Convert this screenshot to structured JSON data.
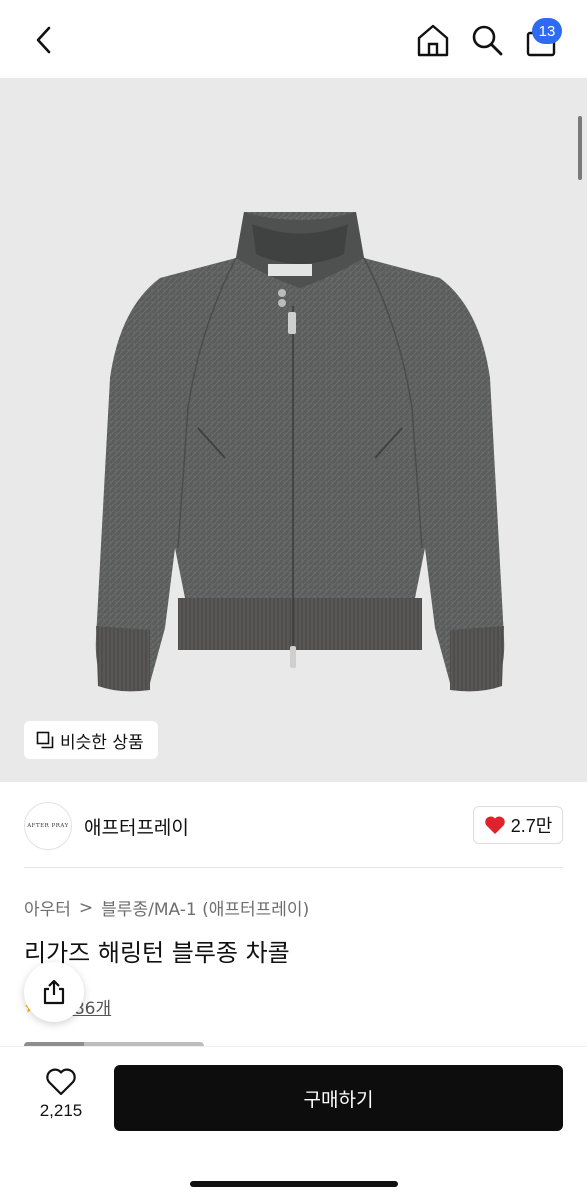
{
  "header": {
    "back_icon": "chevron-left-icon",
    "home_icon": "home-icon",
    "search_icon": "search-icon",
    "cart_icon": "shopping-bag-icon",
    "cart_count": "13",
    "badge_color": "#2f6bf0"
  },
  "hero": {
    "image": "jacket-image",
    "jacket_label": "AFTER PRAY",
    "similar_button_label": "비슷한 상품",
    "similar_icon": "copy-icon"
  },
  "brand": {
    "logo_text": "AFTER PRAY",
    "name": "애프터프레이",
    "likes": "2.7만",
    "heart_color": "#e0222a"
  },
  "product": {
    "category_main": "아우터",
    "category_sep": ">",
    "category_sub": "블루종/MA-1 (애프터프레이)",
    "title": "리가즈 해링턴 블루종 차콜",
    "review_label": "후기 286개",
    "review_visible": "기 286개",
    "share_icon": "share-icon"
  },
  "bottom": {
    "wish_icon": "heart-outline-icon",
    "wish_count": "2,215",
    "buy_label": "구매하기"
  }
}
